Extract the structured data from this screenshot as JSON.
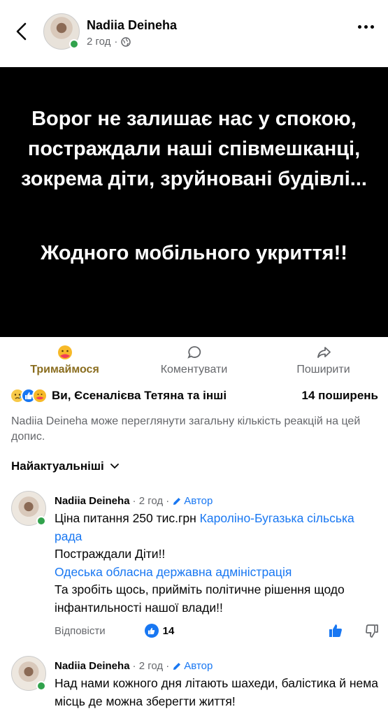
{
  "header": {
    "author": "Nadiia Deineha",
    "time": "2 год",
    "separator": "·"
  },
  "post": {
    "line1": "Ворог не залишає нас у спокою, постраждали наші співмешканці, зокрема діти, зруйновані будівлі...",
    "line2": "Жодного мобільного укриття!!"
  },
  "actions": {
    "react": "Тримаймося",
    "comment": "Коментувати",
    "share": "Поширити"
  },
  "reactions": {
    "names": "Ви, Єсеналієва Тетяна та інші",
    "shares": "14 поширень"
  },
  "note": "Nadiia Deineha може переглянути загальну кількість реакцій на цей допис.",
  "sort_label": "Найактуальніші",
  "comments": [
    {
      "name": "Nadiia Deineha",
      "time": "· 2 год ·",
      "author_badge": "Автор",
      "text1": "Ціна питання 250 тис.грн ",
      "link1": "Кароліно-Бугазька сільська рада",
      "text2": "Постраждали Діти!!",
      "link2": "Одеська обласна державна адміністрація",
      "text3": "Та зробіть щось, прийміть політичне рішення щодо інфантильності нашої влади!!",
      "reply": "Відповісти",
      "likes": "14"
    },
    {
      "name": "Nadiia Deineha",
      "time": "· 2 год ·",
      "author_badge": "Автор",
      "text1": "Над нами кожного дня літають шахеди, балістика й нема місць де можна зберегти життя!"
    }
  ],
  "colors": {
    "accent": "#1877f2",
    "online": "#31a24c",
    "care_reaction_text": "#8a6d1f",
    "post_bg": "#000000"
  }
}
